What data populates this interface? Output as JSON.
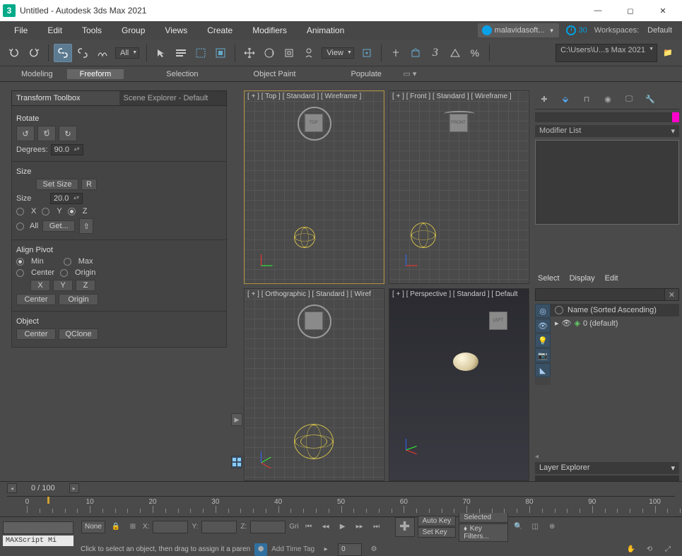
{
  "titlebar": {
    "app_letter": "3",
    "title": "Untitled - Autodesk 3ds Max 2021"
  },
  "menu": [
    "File",
    "Edit",
    "Tools",
    "Group",
    "Views",
    "Create",
    "Modifiers",
    "Animation"
  ],
  "account": {
    "name": "malavidasoft..."
  },
  "credits": "30",
  "workspace": {
    "label": "Workspaces:",
    "value": "Default"
  },
  "toolbar1": {
    "all": "All",
    "view": "View",
    "three": "3",
    "path": "C:\\Users\\U...s Max 2021"
  },
  "ribbon": {
    "tabs": [
      "Modeling",
      "Freeform",
      "Selection",
      "Object Paint",
      "Populate"
    ],
    "active": 1
  },
  "left": {
    "tabs": [
      "Transform Toolbox",
      "Scene Explorer - Default"
    ],
    "rotate": {
      "title": "Rotate",
      "deg_label": "Degrees:",
      "deg_val": "90.0"
    },
    "size": {
      "title": "Size",
      "set": "Set Size",
      "r": "R",
      "label": "Size",
      "val": "20.0",
      "x": "X",
      "y": "Y",
      "z": "Z",
      "all": "All",
      "get": "Get..."
    },
    "align": {
      "title": "Align Pivot",
      "min": "Min",
      "max": "Max",
      "center": "Center",
      "origin": "Origin",
      "x": "X",
      "y": "Y",
      "z": "Z"
    },
    "object": {
      "title": "Object",
      "center": "Center",
      "qclone": "QClone"
    }
  },
  "viewports": {
    "tl": "[ + ] [ Top ] [ Standard ] [ Wireframe ]",
    "tr": "[ + ] [ Front ] [ Standard ] [ Wireframe ]",
    "bl": "[ + ] [ Orthographic ] [ Standard ] [ Wiref",
    "br": "[ + ] [ Perspective ] [ Standard ] [ Default",
    "cube_top": "TOP",
    "cube_front": "FRONT",
    "cube_left": "LEFT"
  },
  "right": {
    "modlist": "Modifier List",
    "tabs": [
      "Select",
      "Display",
      "Edit"
    ],
    "listhead": "Name (Sorted Ascending)",
    "row0": "0 (default)",
    "layer": "Layer Explorer"
  },
  "timeline": {
    "count": "0 / 100",
    "ticks": [
      0,
      10,
      20,
      30,
      40,
      50,
      60,
      70,
      80,
      90,
      100
    ]
  },
  "bottom": {
    "none": "None",
    "x": "X:",
    "y": "Y:",
    "z": "Z:",
    "gri": "Gri",
    "addtime": "Add Time Tag",
    "spin0": "0",
    "autokey": "Auto Key",
    "setkey": "Set Key",
    "selected": "Selected",
    "keyfilters": "Key Filters...",
    "hint": "Click to select an object, then drag to assign it a paren",
    "maxscript": "MAXScript Mi"
  }
}
